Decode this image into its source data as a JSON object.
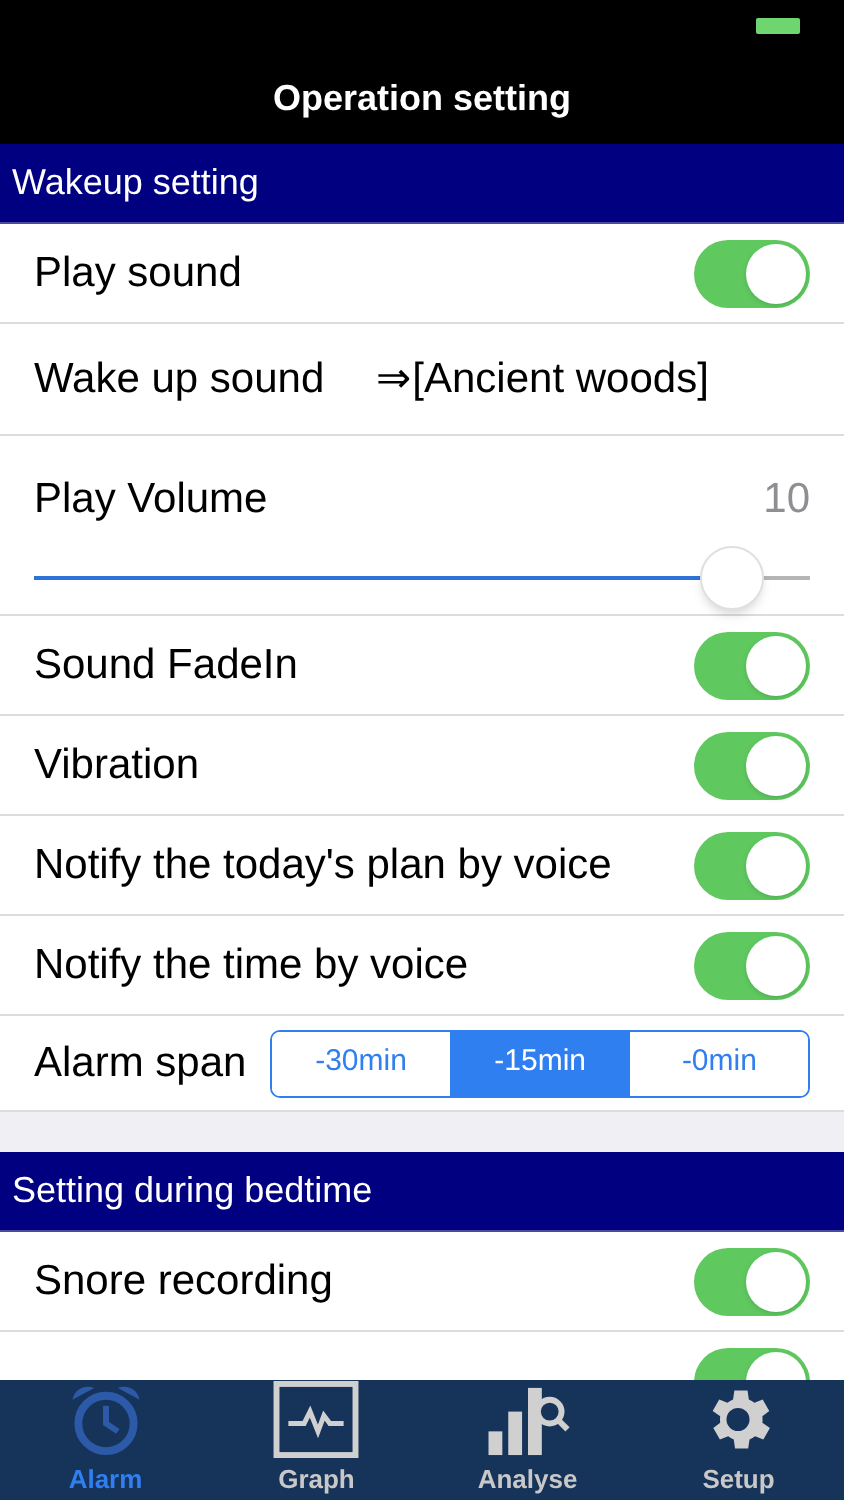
{
  "title": "Operation setting",
  "sections": [
    {
      "header": "Wakeup setting",
      "rows": [
        {
          "kind": "toggle",
          "label": "Play sound",
          "on": true
        },
        {
          "kind": "link",
          "label": "Wake up sound",
          "value": "⇒[Ancient woods]"
        },
        {
          "kind": "slider",
          "label": "Play Volume",
          "value": "10",
          "level": 0.9
        },
        {
          "kind": "toggle",
          "label": "Sound FadeIn",
          "on": true
        },
        {
          "kind": "toggle",
          "label": "Vibration",
          "on": true
        },
        {
          "kind": "toggle",
          "label": "Notify the today's plan by voice",
          "on": true
        },
        {
          "kind": "toggle",
          "label": "Notify the time by voice",
          "on": true
        },
        {
          "kind": "segmented",
          "label": "Alarm span",
          "options": [
            {
              "label": "-30min",
              "selected": false
            },
            {
              "label": "-15min",
              "selected": true
            },
            {
              "label": "-0min",
              "selected": false
            }
          ]
        }
      ]
    },
    {
      "header": "Setting during bedtime",
      "rows": [
        {
          "kind": "toggle",
          "label": "Snore recording",
          "on": true
        },
        {
          "kind": "toggle",
          "on": true
        }
      ]
    }
  ],
  "tabs": [
    {
      "label": "Alarm",
      "selected": true
    },
    {
      "label": "Graph",
      "selected": false
    },
    {
      "label": "Analyse",
      "selected": false
    },
    {
      "label": "Setup",
      "selected": false
    }
  ]
}
